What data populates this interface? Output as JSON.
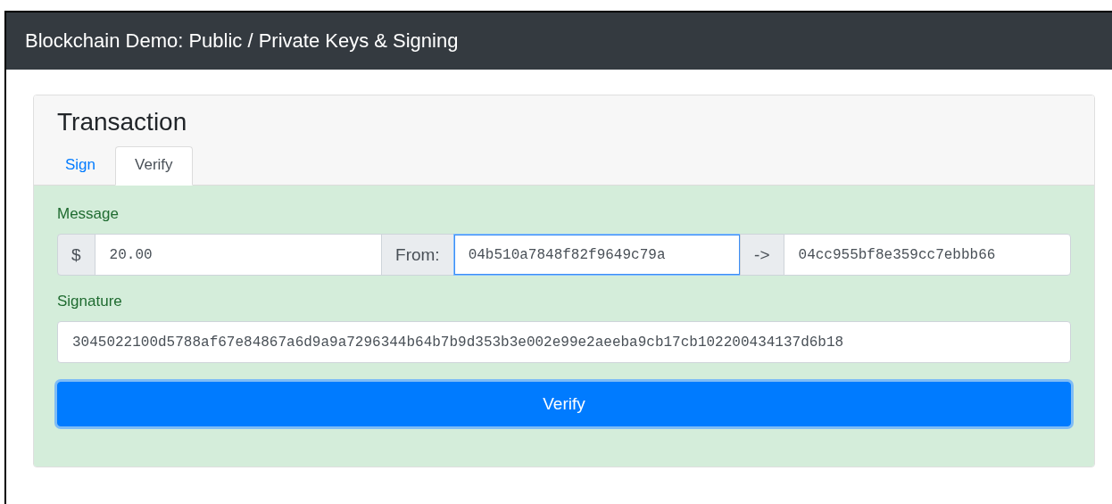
{
  "navbar": {
    "title": "Blockchain Demo: Public / Private Keys & Signing"
  },
  "card": {
    "title": "Transaction",
    "tabs": [
      {
        "label": "Sign",
        "selected": false
      },
      {
        "label": "Verify",
        "selected": true
      }
    ],
    "groups": [
      {
        "label": "Message",
        "parts": [
          {
            "kind": "addon",
            "text": "$"
          },
          {
            "kind": "input",
            "value": "20.00",
            "focused": false
          },
          {
            "kind": "addon",
            "text": "From:"
          },
          {
            "kind": "input",
            "value": "04b510a7848f82f9649c79a",
            "focused": true
          },
          {
            "kind": "addon",
            "text": "->"
          },
          {
            "kind": "input",
            "value": "04cc955bf8e359cc7ebbb66",
            "focused": false
          }
        ]
      },
      {
        "label": "Signature",
        "parts": [
          {
            "kind": "input",
            "value": "3045022100d5788af67e84867a6d9a9a7296344b64b7b9d353b3e002e99e2aeeba9cb17cb102200434137d6b18",
            "focused": false
          }
        ]
      }
    ],
    "button": {
      "label": "Verify"
    }
  }
}
